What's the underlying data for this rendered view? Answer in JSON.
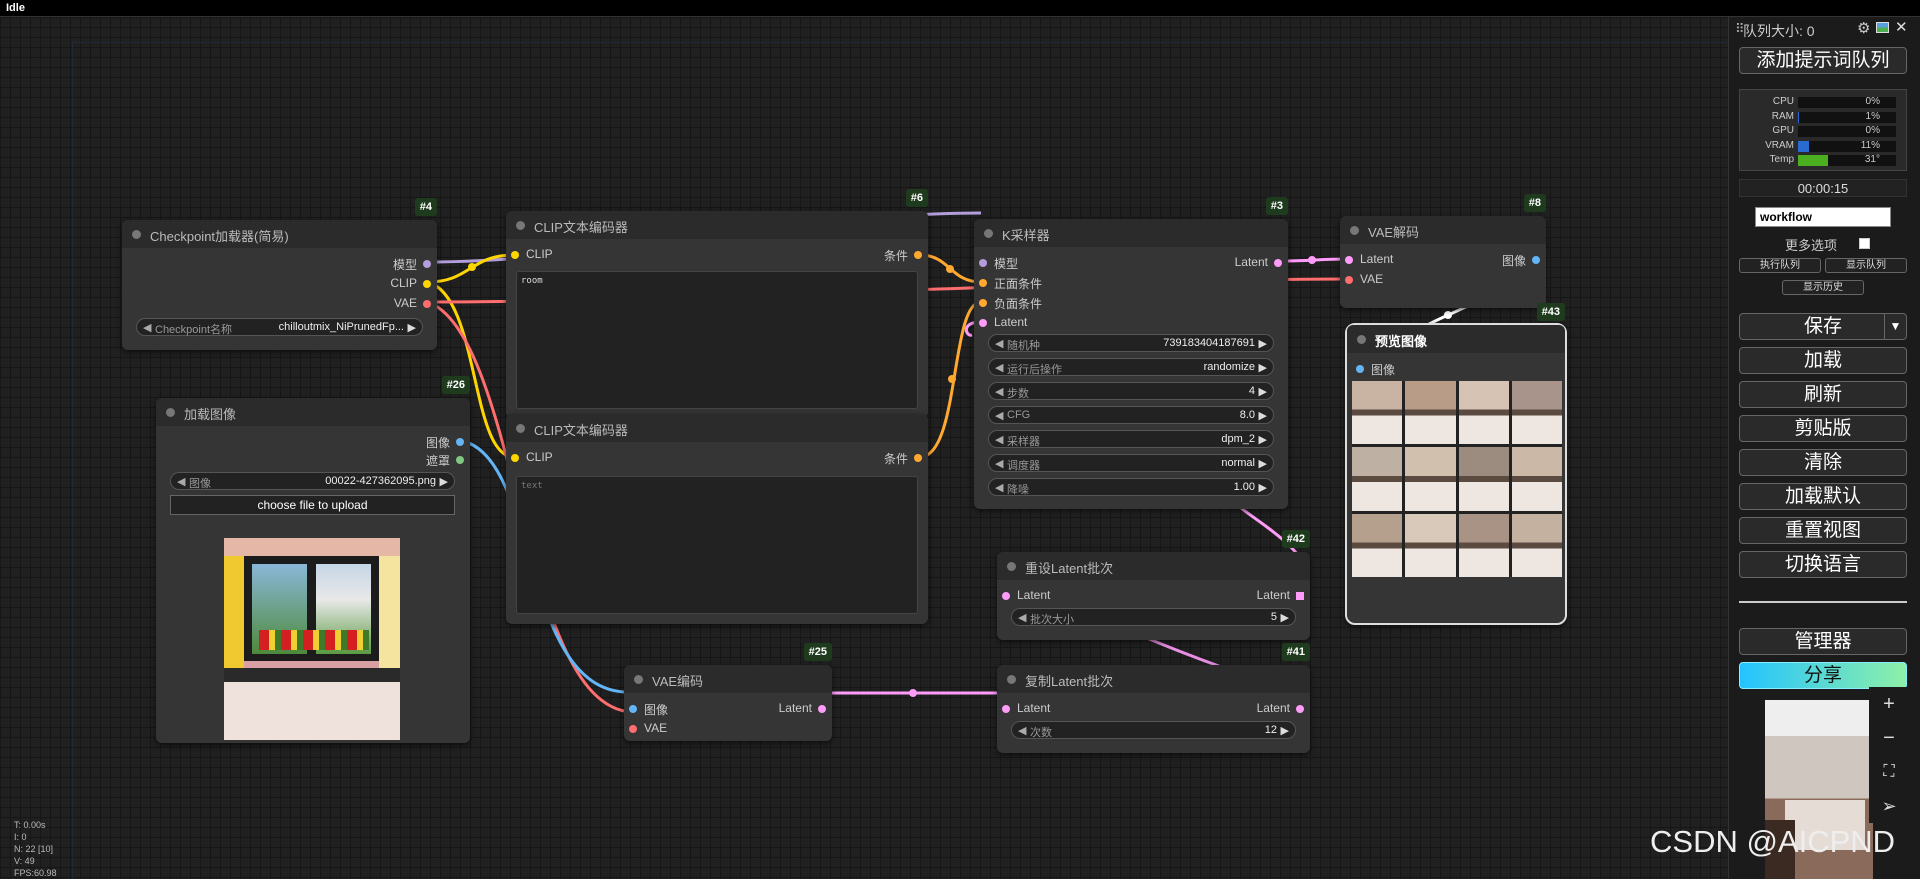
{
  "status_bar": {
    "title": "Idle"
  },
  "nodes": {
    "checkpoint": {
      "id": "#4",
      "title": "Checkpoint加载器(简易)",
      "outputs": [
        "模型",
        "CLIP",
        "VAE"
      ],
      "widget_label": "Checkpoint名称",
      "widget_value": "chilloutmix_NiPrunedFp..."
    },
    "clip1": {
      "id": "#6",
      "title": "CLIP文本编码器",
      "input": "CLIP",
      "output": "条件",
      "text": "room"
    },
    "clip2": {
      "id": "",
      "title": "CLIP文本编码器",
      "input": "CLIP",
      "output": "条件",
      "text": "text"
    },
    "load_image": {
      "id": "#26",
      "title": "加载图像",
      "outputs": [
        "图像",
        "遮罩"
      ],
      "widget_label": "图像",
      "widget_value": "00022-427362095.png",
      "upload_label": "choose file to upload"
    },
    "ksampler": {
      "id": "#3",
      "title": "K采样器",
      "inputs": [
        "模型",
        "正面条件",
        "负面条件",
        "Latent"
      ],
      "output": "Latent",
      "widgets": [
        {
          "label": "随机种",
          "value": "739183404187691"
        },
        {
          "label": "运行后操作",
          "value": "randomize"
        },
        {
          "label": "步数",
          "value": "4"
        },
        {
          "label": "CFG",
          "value": "8.0"
        },
        {
          "label": "采样器",
          "value": "dpm_2"
        },
        {
          "label": "调度器",
          "value": "normal"
        },
        {
          "label": "降噪",
          "value": "1.00"
        }
      ]
    },
    "vae_decode": {
      "id": "#8",
      "title": "VAE解码",
      "inputs": [
        "Latent",
        "VAE"
      ],
      "output": "图像"
    },
    "preview": {
      "id": "#43",
      "title": "预览图像",
      "input": "图像"
    },
    "reset_latent": {
      "id": "#42",
      "title": "重设Latent批次",
      "input": "Latent",
      "output": "Latent",
      "widget_label": "批次大小",
      "widget_value": "5"
    },
    "vae_encode": {
      "id": "#25",
      "title": "VAE编码",
      "inputs": [
        "图像",
        "VAE"
      ],
      "output": "Latent"
    },
    "repeat_latent": {
      "id": "#41",
      "title": "复制Latent批次",
      "input": "Latent",
      "output": "Latent",
      "widget_label": "次数",
      "widget_value": "12"
    }
  },
  "stats": [
    "T: 0.00s",
    "I: 0",
    "N: 22 [10]",
    "V: 49",
    "FPS:60.98"
  ],
  "panel": {
    "queue_size": "队列大小: 0",
    "queue_prompt": "添加提示词队列",
    "monitor": [
      {
        "label": "CPU",
        "value": "0%",
        "fill": 0,
        "color": "#2a6bd1"
      },
      {
        "label": "RAM",
        "value": "1%",
        "fill": 0.01,
        "color": "#2a6bd1"
      },
      {
        "label": "GPU",
        "value": "0%",
        "fill": 0,
        "color": "#2a6bd1"
      },
      {
        "label": "VRAM",
        "value": "11%",
        "fill": 0.11,
        "color": "#2a6bd1"
      },
      {
        "label": "Temp",
        "value": "31°",
        "fill": 0.31,
        "color": "#4caf20"
      }
    ],
    "timer": "00:00:15",
    "workflow_name": "workflow",
    "more_options": "更多选项",
    "view_queue": "执行队列",
    "view_queue2": "显示队列",
    "view_history": "显示历史",
    "buttons": [
      "保存",
      "加载",
      "刷新",
      "剪贴版",
      "清除",
      "加载默认",
      "重置视图",
      "切换语言"
    ],
    "manager": "管理器",
    "share": "分享"
  },
  "watermark": "CSDN @AICPND"
}
